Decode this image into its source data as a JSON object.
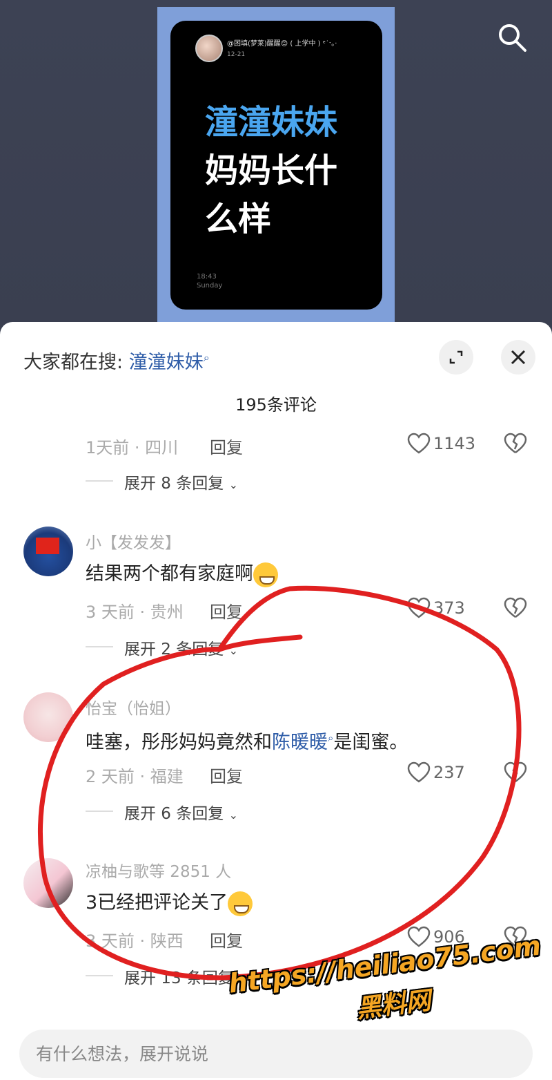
{
  "video": {
    "card": {
      "username": "@困填(梦莱)醒醒😊 ( 上学中 ) ᵉ˙ˑ｡·",
      "date": "12-21",
      "title_highlight": "潼潼妹妹",
      "title_rest_1": "妈妈长什",
      "title_rest_2": "么样",
      "time": "18:43",
      "day": "Sunday"
    },
    "search_icon": "search-icon"
  },
  "sheet": {
    "search_hint_prefix": "大家都在搜:",
    "search_hint_keyword": "潼潼妹妹",
    "comment_count": "195条评论",
    "expand_icon": "expand-icon",
    "close_icon": "close-icon"
  },
  "comments": [
    {
      "time_location": "1天前 · 四川",
      "reply": "回复",
      "likes": "1143",
      "expand": "展开 8 条回复"
    },
    {
      "username": "小【发发发】",
      "text": "结果两个都有家庭啊",
      "emoji": "grinning-sweat-emoji",
      "time_location": "3 天前 · 贵州",
      "reply": "回复",
      "likes": "373",
      "expand": "展开 2 条回复"
    },
    {
      "username": "怡宝（怡姐）",
      "text_before": "哇塞，彤彤妈妈竟然和",
      "text_link": "陈暖暖",
      "text_after": "是闺蜜。",
      "time_location": "2 天前 · 福建",
      "reply": "回复",
      "likes": "237",
      "expand": "展开 6 条回复"
    },
    {
      "username": "凉柚与歌等 2851 人",
      "text": "3已经把评论关了",
      "emoji": "woozy-emoji",
      "time_location": "3 天前 · 陕西",
      "reply": "回复",
      "likes": "906",
      "expand": "展开 13 条回复"
    }
  ],
  "input": {
    "placeholder": "有什么想法，展开说说"
  },
  "watermark": {
    "url": "https://heiliao75.com",
    "name": "黑料网"
  },
  "colors": {
    "link": "#2f5da8",
    "annotation": "#e02020",
    "watermark": "#f5a623"
  }
}
